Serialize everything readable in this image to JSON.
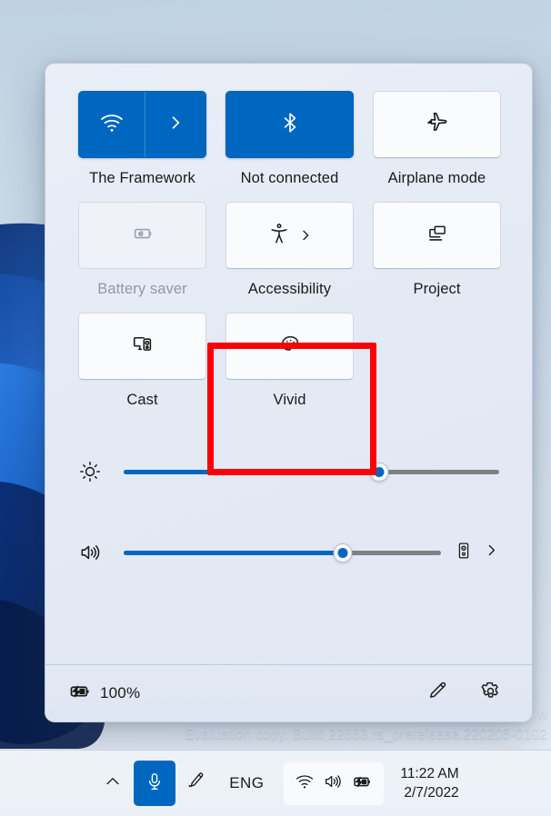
{
  "desktop": {
    "watermark_line1": "w",
    "watermark_line2": "Evaluation copy. Build 22553.rs_prerelease.220205-0102"
  },
  "quick_settings": {
    "tiles": [
      {
        "id": "wifi",
        "label": "The Framework",
        "icon": "wifi-icon",
        "state": "on",
        "has_chevron": true,
        "split": true,
        "disabled": false
      },
      {
        "id": "bluetooth",
        "label": "Not connected",
        "icon": "bluetooth-icon",
        "state": "on",
        "has_chevron": false,
        "split": false,
        "disabled": false
      },
      {
        "id": "airplane",
        "label": "Airplane mode",
        "icon": "airplane-icon",
        "state": "off",
        "has_chevron": false,
        "split": false,
        "disabled": false
      },
      {
        "id": "battery-saver",
        "label": "Battery saver",
        "icon": "battery-saver-icon",
        "state": "off",
        "has_chevron": false,
        "split": false,
        "disabled": true
      },
      {
        "id": "accessibility",
        "label": "Accessibility",
        "icon": "accessibility-icon",
        "state": "off",
        "has_chevron": true,
        "split": false,
        "disabled": false
      },
      {
        "id": "project",
        "label": "Project",
        "icon": "project-icon",
        "state": "off",
        "has_chevron": false,
        "split": false,
        "disabled": false
      },
      {
        "id": "cast",
        "label": "Cast",
        "icon": "cast-icon",
        "state": "off",
        "has_chevron": false,
        "split": false,
        "disabled": false
      },
      {
        "id": "vivid",
        "label": "Vivid",
        "icon": "palette-icon",
        "state": "off",
        "has_chevron": false,
        "split": false,
        "disabled": false
      }
    ],
    "highlight": {
      "target_tile": "vivid",
      "color": "#FC0008"
    },
    "sliders": [
      {
        "id": "brightness",
        "icon": "brightness-icon",
        "value": 68,
        "min": 0,
        "max": 100,
        "trailing": []
      },
      {
        "id": "volume",
        "icon": "volume-icon",
        "value": 69,
        "min": 0,
        "max": 100,
        "trailing": [
          "speaker-output-icon",
          "chevron-right-icon"
        ]
      }
    ],
    "footer": {
      "battery_icon": "battery-charging-icon",
      "battery_percent": "100%",
      "edit_icon": "pencil-icon",
      "settings_icon": "gear-icon"
    }
  },
  "taskbar": {
    "chevron_up_icon": "chevron-up-icon",
    "mic_icon": "microphone-icon",
    "pen_icon": "pen-icon",
    "language": "ENG",
    "status_icons": [
      "wifi-icon",
      "volume-icon",
      "battery-charging-icon"
    ],
    "time": "11:22 AM",
    "date": "2/7/2022"
  },
  "colors": {
    "accent_blue": "#0067C0",
    "highlight_red": "#FC0008",
    "panel_bg": "#E4EAF4",
    "tile_off_bg": "#FAFBFD"
  }
}
